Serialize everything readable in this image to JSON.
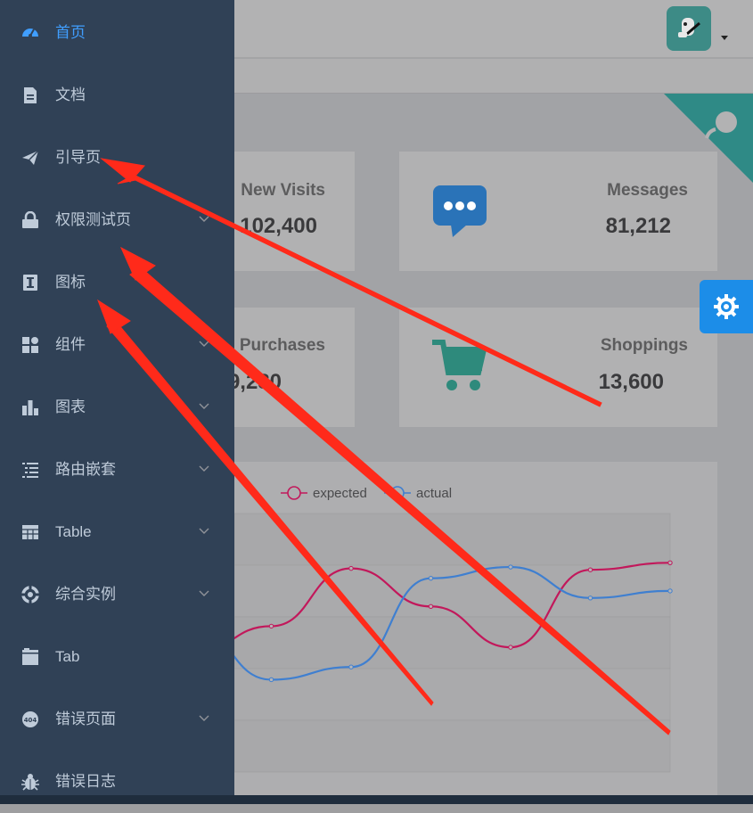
{
  "sidebar": {
    "items": [
      {
        "label": "首页",
        "icon": "dashboard-icon",
        "active": true,
        "has_children": false
      },
      {
        "label": "文档",
        "icon": "document-icon",
        "has_children": false
      },
      {
        "label": "引导页",
        "icon": "paper-plane-icon",
        "has_children": false
      },
      {
        "label": "权限测试页",
        "icon": "lock-icon",
        "has_children": true
      },
      {
        "label": "图标",
        "icon": "icon-font-icon",
        "has_children": false
      },
      {
        "label": "组件",
        "icon": "components-grid-icon",
        "has_children": true
      },
      {
        "label": "图表",
        "icon": "bar-chart-icon",
        "has_children": true
      },
      {
        "label": "路由嵌套",
        "icon": "nested-list-icon",
        "has_children": true
      },
      {
        "label": "Table",
        "icon": "table-icon",
        "has_children": true
      },
      {
        "label": "综合实例",
        "icon": "example-target-icon",
        "has_children": true
      },
      {
        "label": "Tab",
        "icon": "tab-icon",
        "has_children": false
      },
      {
        "label": "错误页面",
        "icon": "error-404-icon",
        "has_children": true
      },
      {
        "label": "错误日志",
        "icon": "bug-icon",
        "has_children": false
      }
    ]
  },
  "cards": [
    {
      "title": "New Visits",
      "value": "102,400"
    },
    {
      "title": "Messages",
      "value": "81,212",
      "icon": "message-bubble-icon",
      "color": "#2a73b8"
    },
    {
      "title": "Purchases",
      "value": "9,280"
    },
    {
      "title": "Shoppings",
      "value": "13,600",
      "icon": "shopping-cart-icon",
      "color": "#2e8a7c"
    }
  ],
  "colors": {
    "sidebar_bg": "#304156",
    "active_text": "#409eff",
    "menu_text": "#bfcbd9",
    "expected_series": "#c2185b",
    "actual_series": "#3f7fd0",
    "annotation_arrow": "#ff2a1a",
    "settings_button": "#1c8de8"
  },
  "chart_data": {
    "type": "line",
    "x": [
      1,
      2,
      3,
      4,
      5,
      6,
      7
    ],
    "series": [
      {
        "name": "expected",
        "values": [
          100,
          120,
          161,
          134,
          105,
          160,
          165
        ]
      },
      {
        "name": "actual",
        "values": [
          120,
          82,
          91,
          154,
          162,
          140,
          145
        ]
      }
    ],
    "ylim": [
      0,
      200
    ],
    "grid": true,
    "legend": "top"
  }
}
